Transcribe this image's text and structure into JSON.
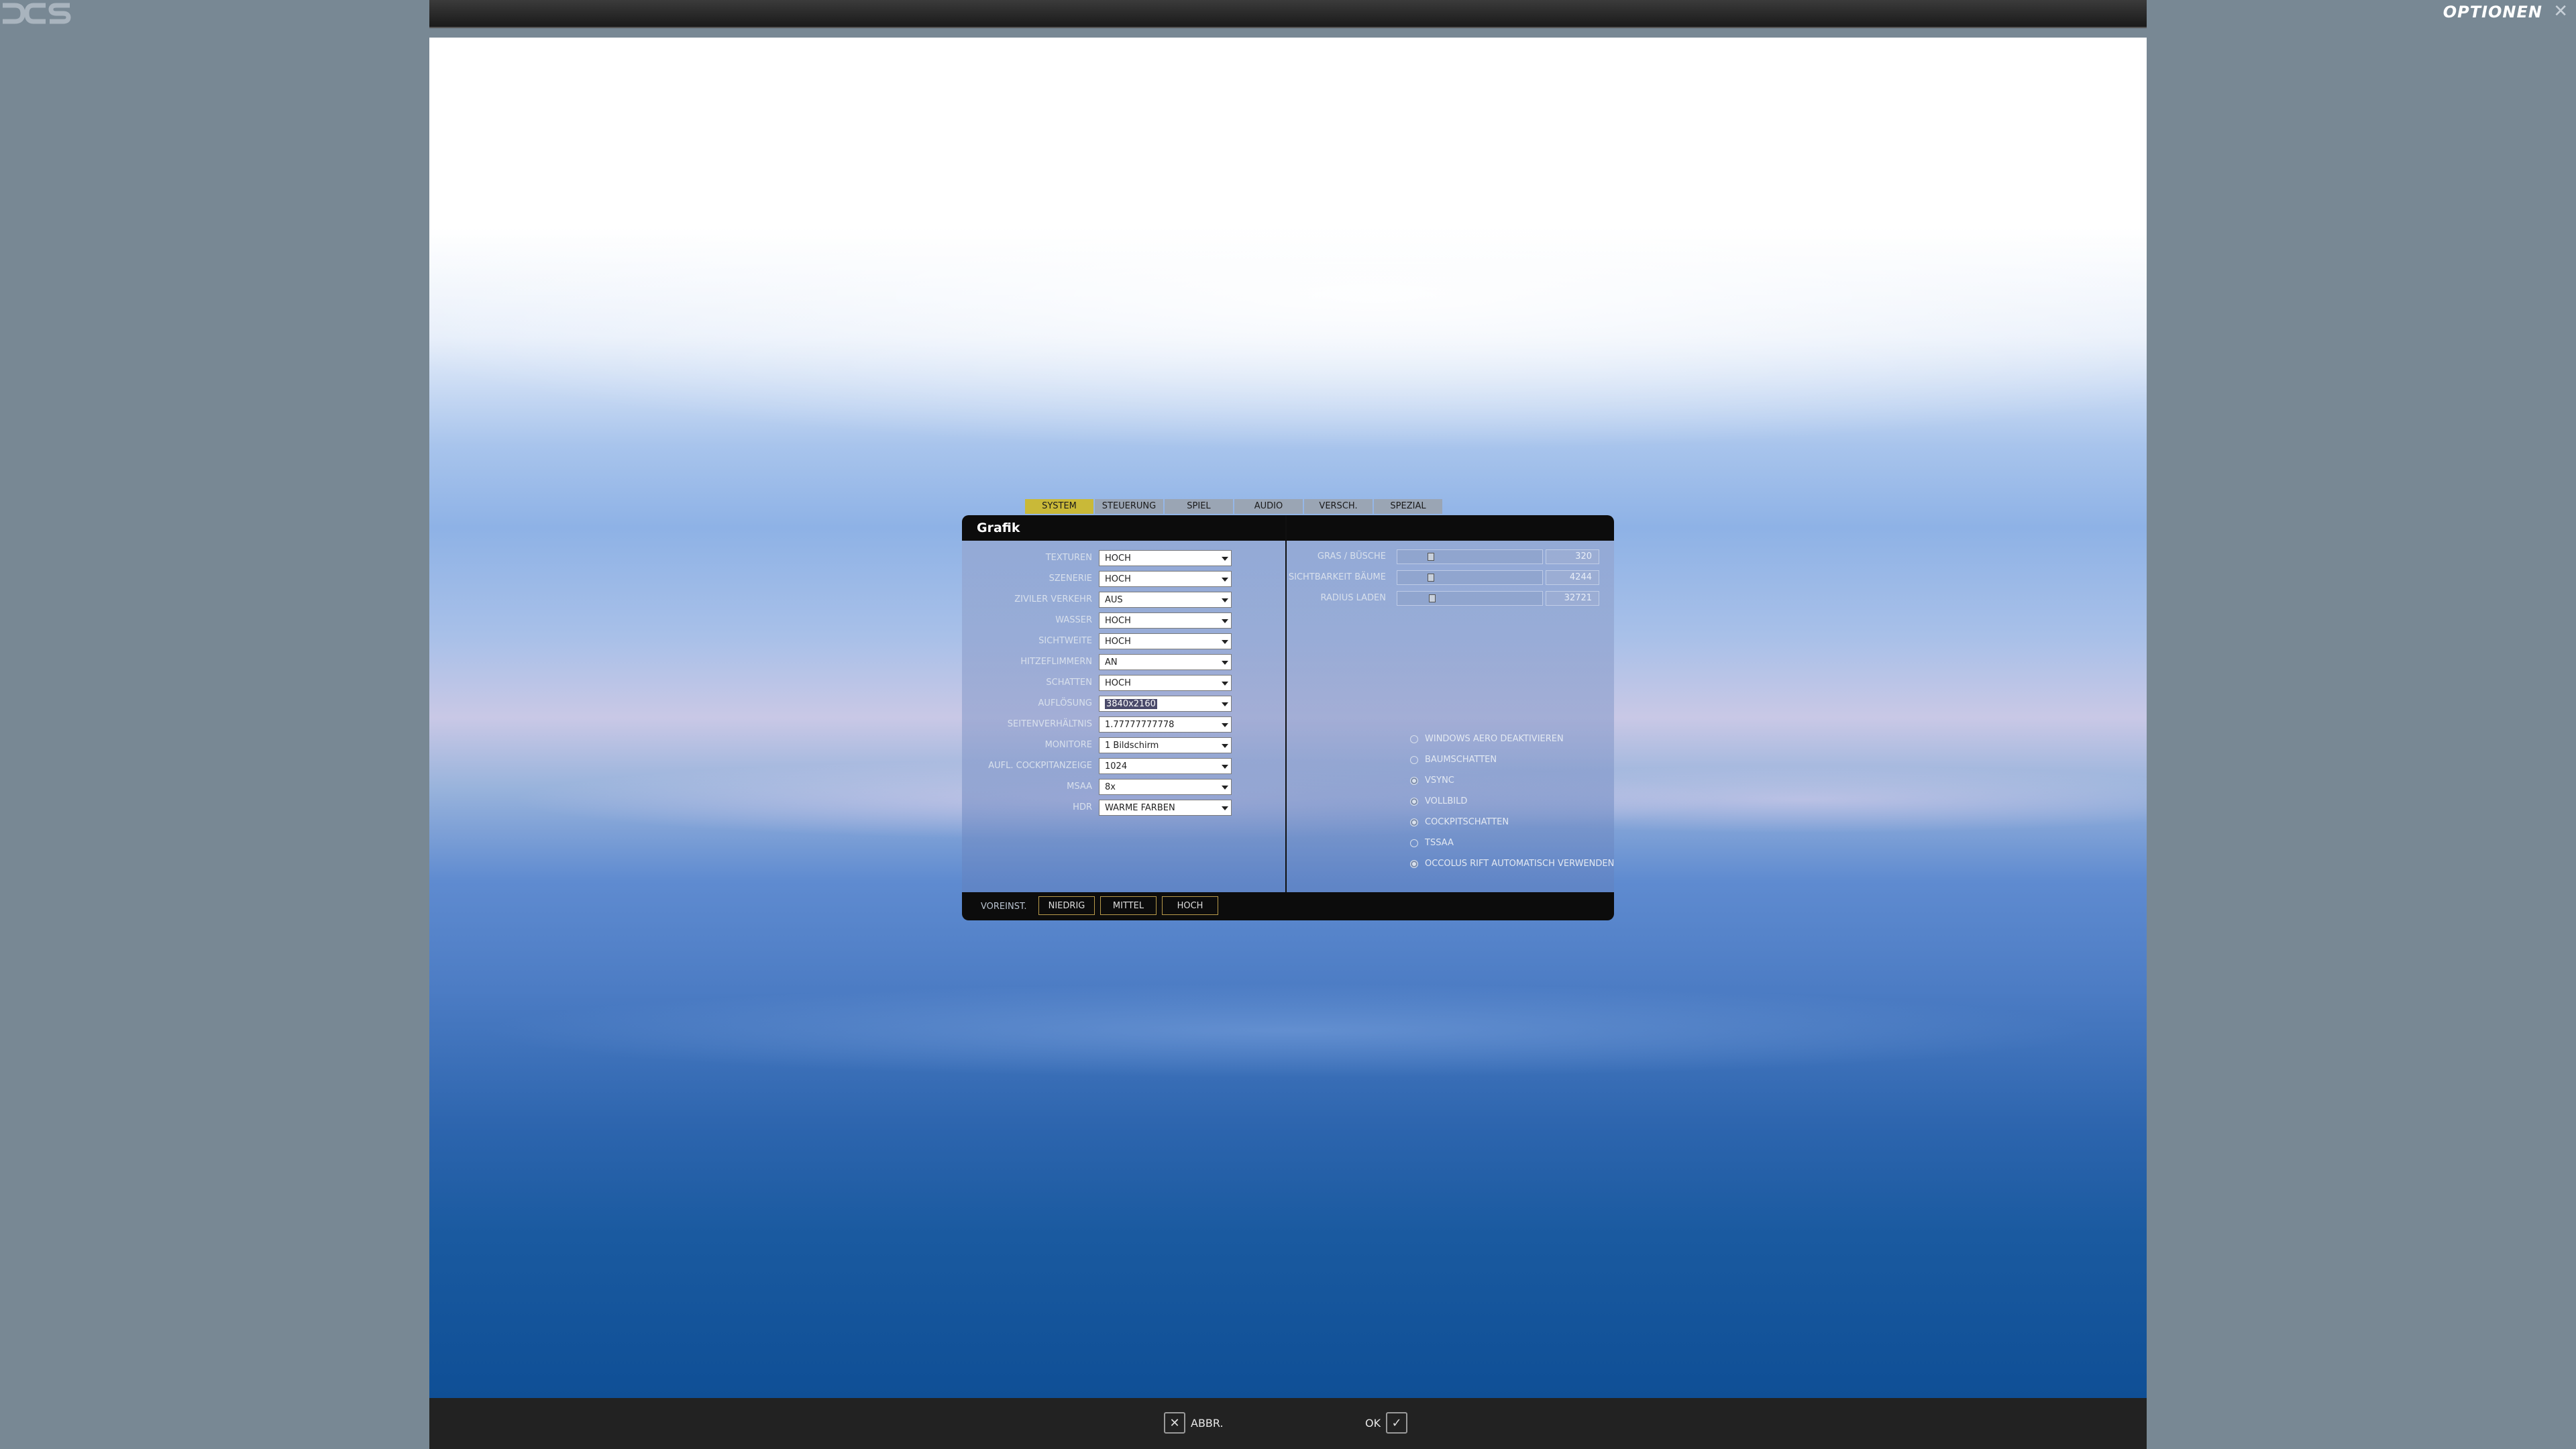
{
  "app": {
    "title": "OPTIONEN",
    "close_symbol": "✕"
  },
  "tabs": [
    {
      "label": "SYSTEM",
      "active": true
    },
    {
      "label": "STEUERUNG",
      "active": false
    },
    {
      "label": "SPIEL",
      "active": false
    },
    {
      "label": "AUDIO",
      "active": false
    },
    {
      "label": "VERSCH.",
      "active": false
    },
    {
      "label": "SPEZIAL",
      "active": false
    }
  ],
  "dialog": {
    "title": "Grafik"
  },
  "settings": [
    {
      "label": "TEXTUREN",
      "value": "HOCH"
    },
    {
      "label": "SZENERIE",
      "value": "HOCH"
    },
    {
      "label": "ZIVILER VERKEHR",
      "value": "AUS"
    },
    {
      "label": "WASSER",
      "value": "HOCH"
    },
    {
      "label": "SICHTWEITE",
      "value": "HOCH"
    },
    {
      "label": "HITZEFLIMMERN",
      "value": "AN"
    },
    {
      "label": "SCHATTEN",
      "value": "HOCH"
    },
    {
      "label": "AUFLÖSUNG",
      "value": "3840x2160"
    },
    {
      "label": "SEITENVERHÄLTNIS",
      "value": "1.77777777778"
    },
    {
      "label": "MONITORE",
      "value": "1 Bildschirm"
    },
    {
      "label": "AUFL. COCKPITANZEIGE",
      "value": "1024"
    },
    {
      "label": "MSAA",
      "value": "8x"
    },
    {
      "label": "HDR",
      "value": "WARME FARBEN"
    }
  ],
  "sliders": [
    {
      "label": "GRAS / BÜSCHE",
      "value": "320",
      "level": 0.22
    },
    {
      "label": "SICHTBARKEIT BÄUME",
      "value": "4244",
      "level": 0.22
    },
    {
      "label": "RADIUS LADEN",
      "value": "32721",
      "level": 0.23
    }
  ],
  "checkboxes": [
    {
      "label": "WINDOWS AERO DEAKTIVIEREN",
      "checked": false
    },
    {
      "label": "BAUMSCHATTEN",
      "checked": false
    },
    {
      "label": "VSYNC",
      "checked": true
    },
    {
      "label": "VOLLBILD",
      "checked": true
    },
    {
      "label": "COCKPITSCHATTEN",
      "checked": true
    },
    {
      "label": "TSSAA",
      "checked": false
    },
    {
      "label": "OCCOLUS RIFT AUTOMATISCH VERWENDEN",
      "checked": true
    }
  ],
  "presets": {
    "label": "VOREINST.",
    "buttons": [
      "NIEDRIG",
      "MITTEL",
      "HOCH"
    ]
  },
  "footer": {
    "cancel_label": "ABBR.",
    "ok_label": "OK",
    "cancel_icon": "close-icon",
    "ok_icon": "checkmark-icon"
  }
}
